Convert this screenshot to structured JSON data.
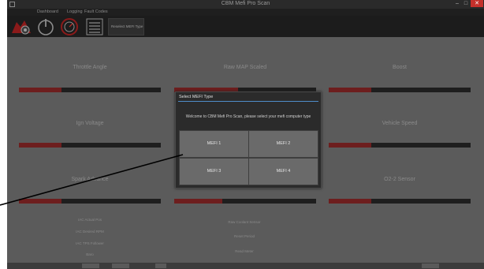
{
  "window": {
    "title": "CBM Mefi Pro Scan"
  },
  "menu": {
    "items": [
      "Dashboard",
      "Logging",
      "Fault Codes"
    ]
  },
  "toolbar": {
    "status_text": "Reselect MEFI Type"
  },
  "gauges": [
    {
      "label": "Throttle Angle",
      "level_pct": 30
    },
    {
      "label": "Raw MAP Scaled",
      "level_pct": 45
    },
    {
      "label": "Boost",
      "level_pct": 30
    },
    {
      "label": "Ign Voltage",
      "level_pct": 30
    },
    {
      "label": "Vehicle Speed",
      "level_pct": 30
    },
    {
      "label": "Spark Advance",
      "level_pct": 30
    },
    {
      "label": "O2-2 Sensor",
      "level_pct": 30
    }
  ],
  "indicators": {
    "left": [
      "IAC Actual Pos",
      "IAC Desired RPM",
      "IAC TPS Follower",
      "Baro"
    ],
    "center": [
      "Raw Coolant Sensor",
      "Reset Period",
      "Read Meter"
    ]
  },
  "modal": {
    "title": "Select MEFI Type",
    "message": "Welcome to CBM Mefi Pro Scan, please select your mefi computer type",
    "options": [
      "MEFI 1",
      "MEFI 2",
      "MEFI 3",
      "MEFI 4"
    ]
  },
  "colors": {
    "background": "#5b5b5b",
    "bar_fill": "#6d1e1e",
    "accent_rule": "#4f8cc9",
    "close_button": "#c4302b"
  },
  "icons": [
    "app-icon",
    "logo",
    "power-icon",
    "engine-gauge-icon",
    "menu-lines-icon"
  ]
}
